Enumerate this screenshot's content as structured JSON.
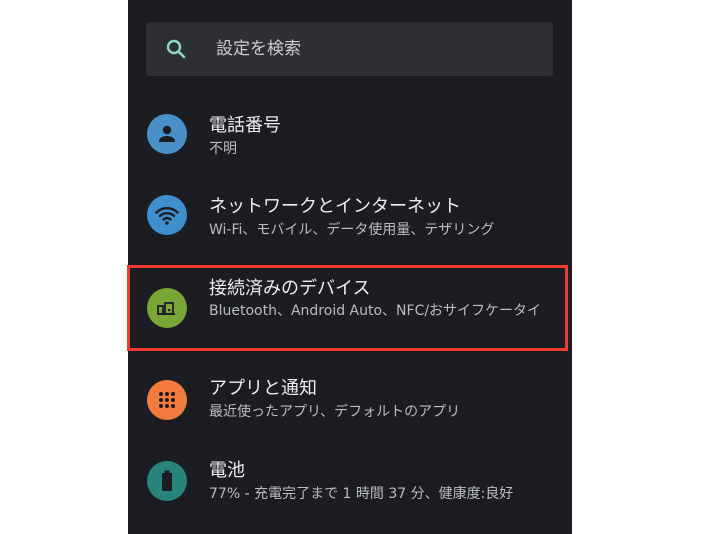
{
  "search": {
    "placeholder": "設定を検索",
    "icon": "search-icon"
  },
  "items": [
    {
      "title": "電話番号",
      "subtitle": "不明",
      "icon": "person-icon",
      "color": "#4a90c8"
    },
    {
      "title": "ネットワークとインターネット",
      "subtitle": "Wi-Fi、モバイル、データ使用量、テザリング",
      "icon": "wifi-icon",
      "color": "#3d8fce"
    },
    {
      "title": "接続済みのデバイス",
      "subtitle": "Bluetooth、Android Auto、NFC/おサイフケータイ",
      "icon": "devices-icon",
      "color": "#7aa637"
    },
    {
      "title": "アプリと通知",
      "subtitle": "最近使ったアプリ、デフォルトのアプリ",
      "icon": "apps-icon",
      "color": "#f07b3c"
    },
    {
      "title": "電池",
      "subtitle": "77% - 充電完了まで 1 時間 37 分、健康度:良好",
      "icon": "battery-icon",
      "color": "#28847a"
    }
  ],
  "colors": {
    "highlight": "#ef3a32",
    "background": "#1c1d22"
  }
}
